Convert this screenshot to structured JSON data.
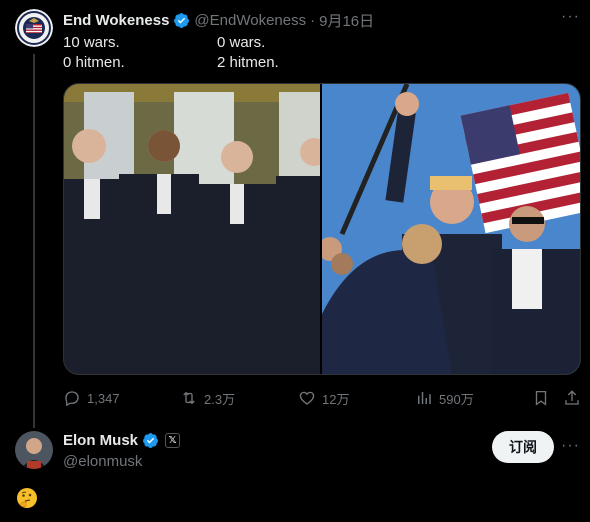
{
  "post1": {
    "display_name": "End Wokeness",
    "handle": "@EndWokeness",
    "separator": "·",
    "date": "9月16日",
    "avatar_icon": "flag-seal-avatar",
    "text_left": [
      "10 wars.",
      "0 hitmen."
    ],
    "text_right": [
      "0 wars.",
      "2 hitmen."
    ],
    "media": [
      "four-presidents-photo",
      "rally-photo"
    ],
    "stats": {
      "replies": "1,347",
      "reposts": "2.3万",
      "likes": "12万",
      "views": "590万"
    }
  },
  "post2": {
    "display_name": "Elon Musk",
    "handle": "@elonmusk",
    "affiliation_badge": "𝕏",
    "subscribe_label": "订阅",
    "reply_emoji": "🤔"
  },
  "colors": {
    "background": "#000000",
    "text": "#e7e9ea",
    "muted": "#71767b",
    "verified": "#1d9bf0",
    "button_bg": "#eff3f4"
  }
}
